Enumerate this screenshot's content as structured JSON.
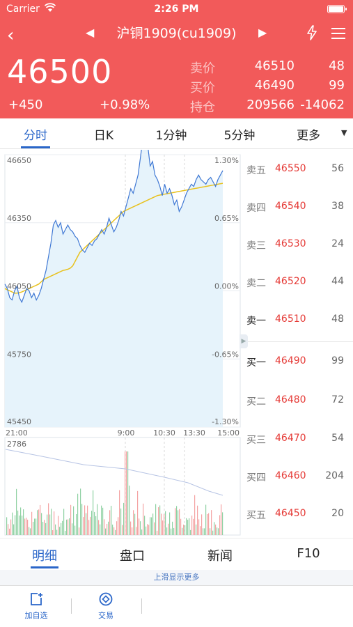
{
  "status_bar": {
    "carrier": "Carrier",
    "time": "2:26 PM"
  },
  "nav": {
    "title": "沪铜1909(cu1909)"
  },
  "quote": {
    "last_price": "46500",
    "change": "+450",
    "change_pct": "+0.98%",
    "rows": [
      {
        "label": "卖价",
        "value": "46510",
        "qty": "48"
      },
      {
        "label": "买价",
        "value": "46490",
        "qty": "99"
      },
      {
        "label": "持仓",
        "value": "209566",
        "qty": "-14062"
      }
    ]
  },
  "tabs": [
    "分时",
    "日K",
    "1分钟",
    "5分钟",
    "更多"
  ],
  "active_tab": "分时",
  "chart_data": {
    "type": "line",
    "series": [
      {
        "name": "",
        "values": [
          46080,
          46060,
          46020,
          46010,
          46050,
          46070,
          46020,
          46000,
          46030,
          46060,
          46050,
          46020,
          46040,
          46010,
          46030,
          46060,
          46100,
          46140,
          46200,
          46260,
          46340,
          46360,
          46330,
          46350,
          46300,
          46320,
          46340,
          46320,
          46310,
          46290,
          46280,
          46250,
          46230,
          46220,
          46240,
          46260,
          46250,
          46270,
          46280,
          46300,
          46320,
          46300,
          46330,
          46370,
          46340,
          46310,
          46330,
          46360,
          46400,
          46380,
          46420,
          46460,
          46500,
          46480,
          46520,
          46560,
          46640,
          46720,
          46800,
          46690,
          46600,
          46620,
          46560,
          46540,
          46510,
          46470,
          46520,
          46480,
          46500,
          46470,
          46430,
          46450,
          46400,
          46420,
          46450,
          46480,
          46500,
          46520,
          46510,
          46540,
          46560,
          46540,
          46530,
          46520,
          46540,
          46550,
          46530,
          46510,
          46540,
          46560,
          46580
        ]
      },
      {
        "name": "",
        "values": [
          46060,
          46055,
          46050,
          46045,
          46040,
          46040,
          46042,
          46045,
          46050,
          46055,
          46060,
          46065,
          46070,
          46075,
          46080,
          46090,
          46100,
          46105,
          46110,
          46115,
          46120,
          46125,
          46130,
          46135,
          46140,
          46142,
          46145,
          46150,
          46160,
          46180,
          46200,
          46220,
          46230,
          46240,
          46250,
          46260,
          46270,
          46280,
          46290,
          46300,
          46310,
          46320,
          46330,
          46340,
          46350,
          46360,
          46370,
          46380,
          46390,
          46400,
          46405,
          46410,
          46415,
          46420,
          46425,
          46430,
          46435,
          46440,
          46445,
          46450,
          46455,
          46460,
          46465,
          46470,
          46472,
          46474,
          46476,
          46478,
          46480,
          46482,
          46484,
          46486,
          46488,
          46490,
          46492,
          46494,
          46496,
          46498,
          46500,
          46502,
          46504,
          46506,
          46508,
          46510,
          46512,
          46514,
          46516,
          46518,
          46520,
          46522,
          46524
        ]
      }
    ],
    "y_ticks_left": [
      "46650",
      "46350",
      "46050",
      "45750",
      "45450"
    ],
    "y_ticks_right": [
      "1.30%",
      "0.65%",
      "0.00%",
      "-0.65%",
      "-1.30%"
    ],
    "ylim": [
      45450,
      46650
    ],
    "x_ticks": [
      "21:00",
      "9:00",
      "10:30",
      "13:30",
      "15:00"
    ],
    "volume_max_label": "2786",
    "grid": true
  },
  "order_book": {
    "asks": [
      {
        "label": "卖五",
        "price": "46550",
        "qty": "56"
      },
      {
        "label": "卖四",
        "price": "46540",
        "qty": "38"
      },
      {
        "label": "卖三",
        "price": "46530",
        "qty": "24"
      },
      {
        "label": "卖二",
        "price": "46520",
        "qty": "44"
      },
      {
        "label": "卖一",
        "price": "46510",
        "qty": "48"
      }
    ],
    "bids": [
      {
        "label": "买一",
        "price": "46490",
        "qty": "99"
      },
      {
        "label": "买二",
        "price": "46480",
        "qty": "72"
      },
      {
        "label": "买三",
        "price": "46470",
        "qty": "54"
      },
      {
        "label": "买四",
        "price": "46460",
        "qty": "204"
      },
      {
        "label": "买五",
        "price": "46450",
        "qty": "20"
      }
    ]
  },
  "bottom_tabs": [
    "明细",
    "盘口",
    "新闻",
    "F10"
  ],
  "more_hint": "上滑显示更多",
  "toolbar": [
    {
      "label": "加自选",
      "icon": "add-watchlist-icon"
    },
    {
      "label": "交易",
      "icon": "trade-icon"
    }
  ],
  "colors": {
    "header": "#f25a5a",
    "accent": "#2a66c9",
    "price_line": "#3f78d4",
    "avg_line": "#e8c11c",
    "up": "#e53935"
  }
}
